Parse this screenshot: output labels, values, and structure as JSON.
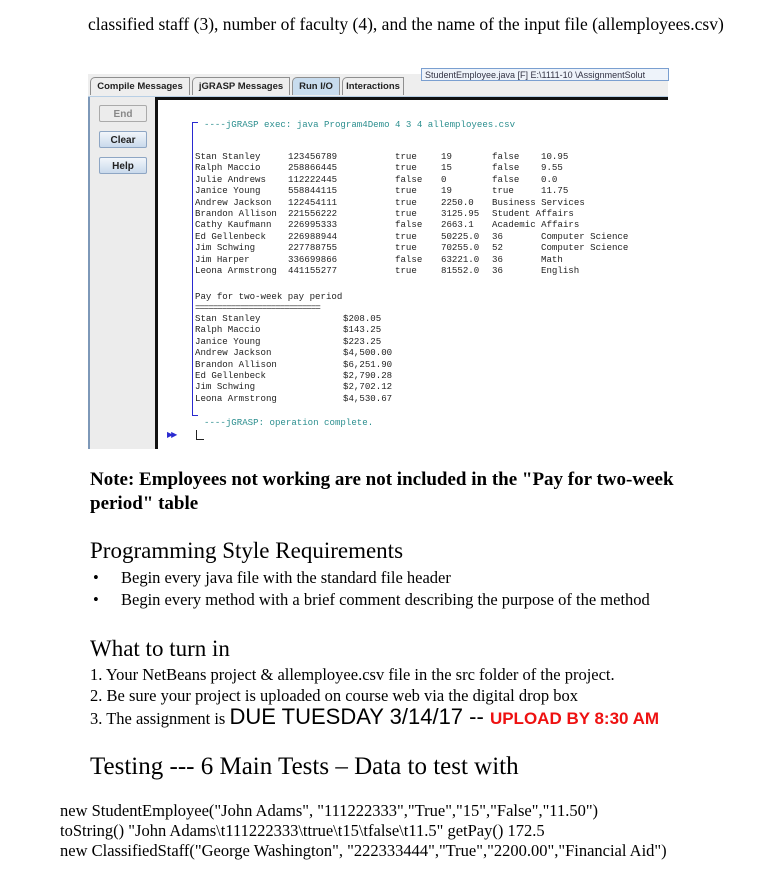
{
  "intro_text": "classified staff (3), number of faculty (4), and the name of the input file (allemployees.csv)",
  "jgrasp": {
    "tabs": [
      {
        "label": "Compile Messages",
        "active": false
      },
      {
        "label": "jGRASP Messages",
        "active": false
      },
      {
        "label": "Run I/O",
        "active": true
      },
      {
        "label": "Interactions",
        "active": false
      }
    ],
    "file_label": "StudentEmployee.java [F] E:\\1111-10 \\AssignmentSolut",
    "buttons": {
      "end": "End",
      "clear": "Clear",
      "help": "Help"
    },
    "exec_line": "----jGRASP exec: java Program4Demo 4 3 4 allemployees.csv",
    "employees": [
      [
        "Stan Stanley",
        "123456789",
        "true",
        "19",
        "false",
        "10.95"
      ],
      [
        "Ralph Maccio",
        "258866445",
        "true",
        "15",
        "false",
        "9.55"
      ],
      [
        "Julie Andrews",
        "112222445",
        "false",
        "0",
        "false",
        "0.0"
      ],
      [
        "Janice Young",
        "558844115",
        "true",
        "19",
        "true",
        "11.75"
      ],
      [
        "Andrew Jackson",
        "122454111",
        "true",
        "2250.0",
        "Business Services",
        ""
      ],
      [
        "Brandon Allison",
        "221556222",
        "true",
        "3125.95",
        "Student Affairs",
        ""
      ],
      [
        "Cathy Kaufmann",
        "226995333",
        "false",
        "2663.1",
        "Academic Affairs",
        ""
      ],
      [
        "Ed Gellenbeck",
        "226988944",
        "true",
        "50225.0",
        "36",
        "Computer Science"
      ],
      [
        "Jim Schwing",
        "227788755",
        "true",
        "70255.0",
        "52",
        "Computer Science"
      ],
      [
        "Jim Harper",
        "336699866",
        "false",
        "63221.0",
        "36",
        "Math"
      ],
      [
        "Leona Armstrong",
        "441155277",
        "true",
        "81552.0",
        "36",
        "English"
      ]
    ],
    "pay_title": "Pay for two-week pay period",
    "pay_rule": "============================",
    "pay": [
      [
        "Stan Stanley",
        "$208.05"
      ],
      [
        "Ralph Maccio",
        "$143.25"
      ],
      [
        "Janice Young",
        "$223.25"
      ],
      [
        "Andrew Jackson",
        "$4,500.00"
      ],
      [
        "Brandon Allison",
        "$6,251.90"
      ],
      [
        "Ed Gellenbeck",
        "$2,790.28"
      ],
      [
        "Jim Schwing",
        "$2,702.12"
      ],
      [
        "Leona Armstrong",
        "$4,530.67"
      ]
    ],
    "done_line": "----jGRASP: operation complete.",
    "arrow_glyph": "▶▶"
  },
  "note": "Note: Employees not working are not included in the \"Pay for two-week period\" table",
  "style_section": {
    "heading": "Programming Style Requirements",
    "bullet_glyph": "•",
    "items": [
      "Begin every java file with the standard file header",
      "Begin every method with a brief comment describing the purpose of the method"
    ]
  },
  "turn_in": {
    "heading": "What to turn in",
    "item1": "1. Your NetBeans project & allemployee.csv file in the src folder of the project.",
    "item2": "2. Be sure your project is uploaded on course web via the  digital drop box",
    "item3_prefix": "3. The assignment is ",
    "item3_due": "DUE TUESDAY 3/14/17",
    "item3_sep": " -- ",
    "item3_upload": "UPLOAD BY 8:30  AM",
    "upload_color": "#ee1111"
  },
  "testing": {
    "heading": "Testing  ---  6 Main Tests – Data to test with",
    "lines": [
      "new StudentEmployee(\"John Adams\", \"111222333\",\"True\",\"15\",\"False\",\"11.50\")",
      "toString() \"John Adams\\t111222333\\ttrue\\t15\\tfalse\\t11.5\" getPay() 172.5",
      "new ClassifiedStaff(\"George Washington\", \"222333444\",\"True\",\"2200.00\",\"Financial Aid\")"
    ]
  }
}
